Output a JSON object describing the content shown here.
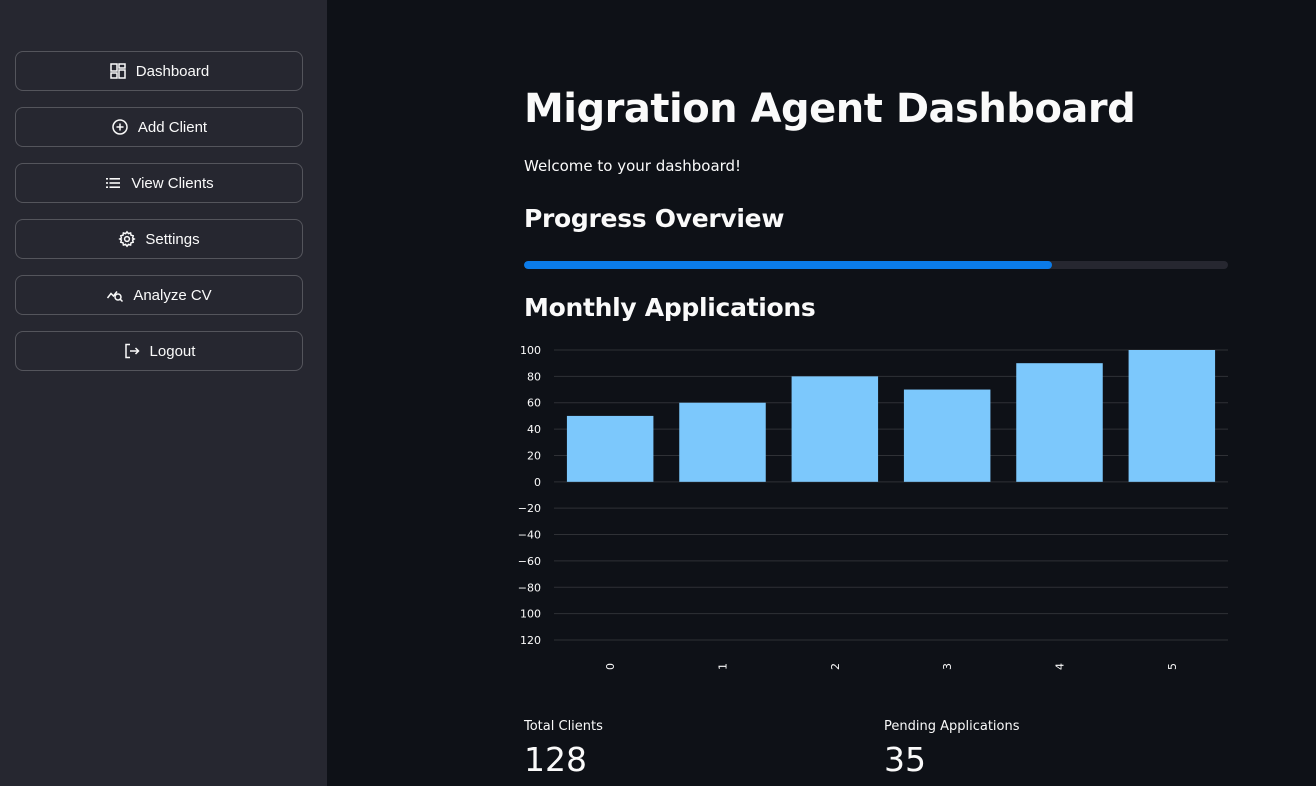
{
  "sidebar": {
    "items": [
      {
        "label": "Dashboard",
        "icon": "dashboard-icon"
      },
      {
        "label": "Add Client",
        "icon": "add-circle-icon"
      },
      {
        "label": "View Clients",
        "icon": "list-icon"
      },
      {
        "label": "Settings",
        "icon": "gear-icon"
      },
      {
        "label": "Analyze CV",
        "icon": "analytics-search-icon"
      },
      {
        "label": "Logout",
        "icon": "logout-icon"
      }
    ]
  },
  "main": {
    "title": "Migration Agent Dashboard",
    "welcome": "Welcome to your dashboard!",
    "progress_heading": "Progress Overview",
    "progress_value": 0.75,
    "chart_heading": "Monthly Applications",
    "metrics": [
      {
        "label": "Total Clients",
        "value": "128"
      },
      {
        "label": "Pending Applications",
        "value": "35"
      }
    ]
  },
  "colors": {
    "background": "#0e1117",
    "sidebar": "#262730",
    "accent": "#0b7be8",
    "bar": "#7cc8fc"
  },
  "chart_data": {
    "type": "bar",
    "categories": [
      "0",
      "1",
      "2",
      "3",
      "4",
      "5"
    ],
    "values": [
      50,
      60,
      80,
      70,
      90,
      100
    ],
    "title": "",
    "xlabel": "",
    "ylabel": "",
    "ylim": [
      -120,
      100
    ],
    "yticks": [
      100,
      80,
      60,
      40,
      20,
      0,
      -20,
      -40,
      -60,
      -80,
      -100,
      -120
    ],
    "ytick_labels": [
      "100",
      "80",
      "60",
      "40",
      "20",
      "0",
      "−20",
      "−40",
      "−60",
      "−80",
      "100",
      "120"
    ],
    "grid": true
  }
}
